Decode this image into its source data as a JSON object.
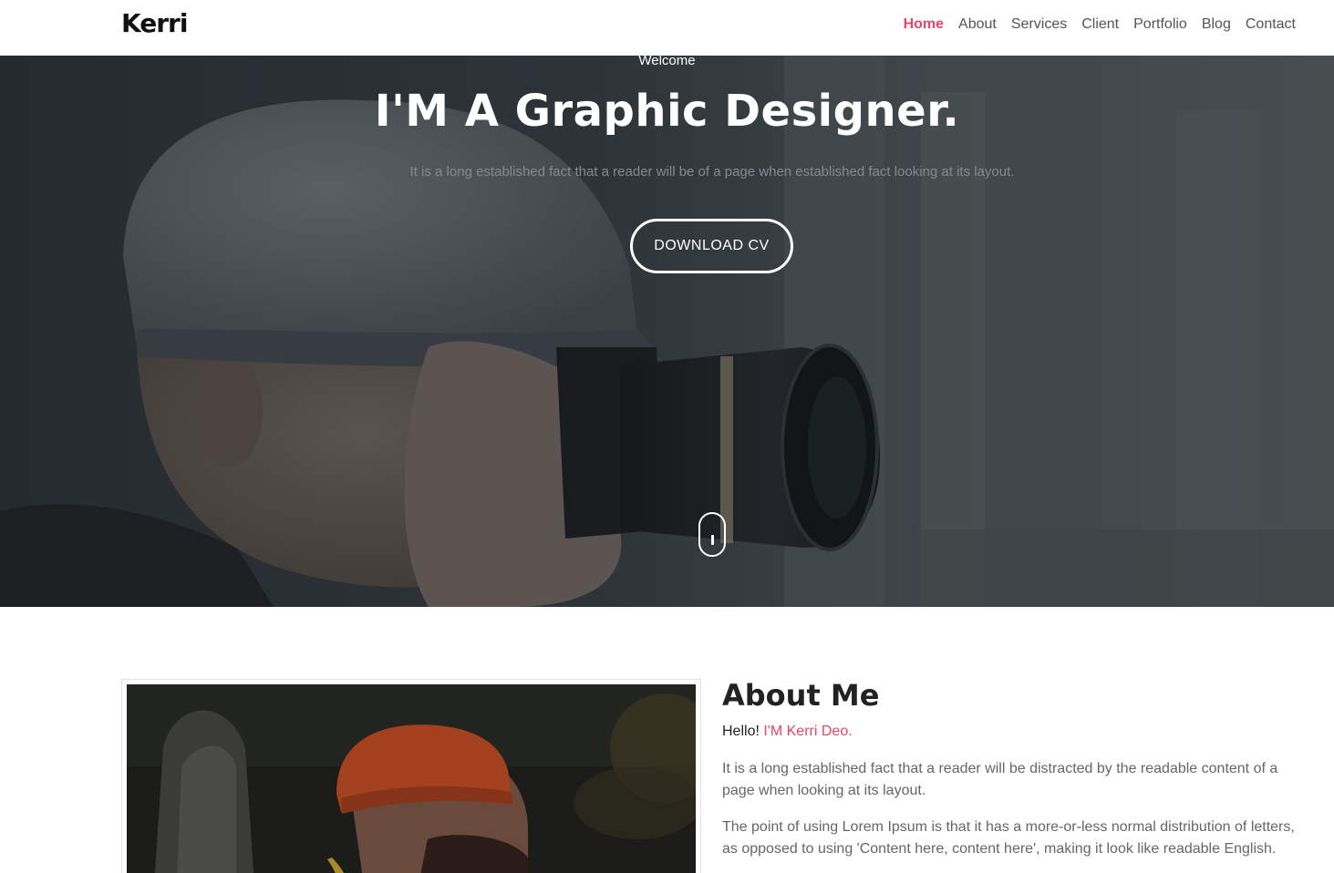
{
  "brand": {
    "name": "Kerri"
  },
  "nav": {
    "items": [
      {
        "label": "Home",
        "active": true
      },
      {
        "label": "About",
        "active": false
      },
      {
        "label": "Services",
        "active": false
      },
      {
        "label": "Client",
        "active": false
      },
      {
        "label": "Portfolio",
        "active": false
      },
      {
        "label": "Blog",
        "active": false
      },
      {
        "label": "Contact",
        "active": false
      }
    ]
  },
  "hero": {
    "welcome": "Welcome",
    "title": "I'M A Graphic Designer.",
    "subtitle": "It is a long established fact that a reader will be of a page when established fact looking at its layout.",
    "button_label": "DOWNLOAD CV",
    "scroll_icon": "mouse-scroll-icon"
  },
  "about": {
    "title": "About Me",
    "hello_prefix": "Hello!",
    "hello_name": "I'M Kerri Deo.",
    "paragraph1": "It is a long established fact that a reader will be distracted by the readable content of a page when looking at its layout.",
    "paragraph2": "The point of using Lorem Ipsum is that it has a more-or-less normal distribution of letters, as opposed to using 'Content here, content here', making it look like readable English."
  },
  "colors": {
    "accent": "#e2466a",
    "hero_overlay": "#191e24",
    "text_dark": "#222222",
    "text_muted": "#666666"
  }
}
